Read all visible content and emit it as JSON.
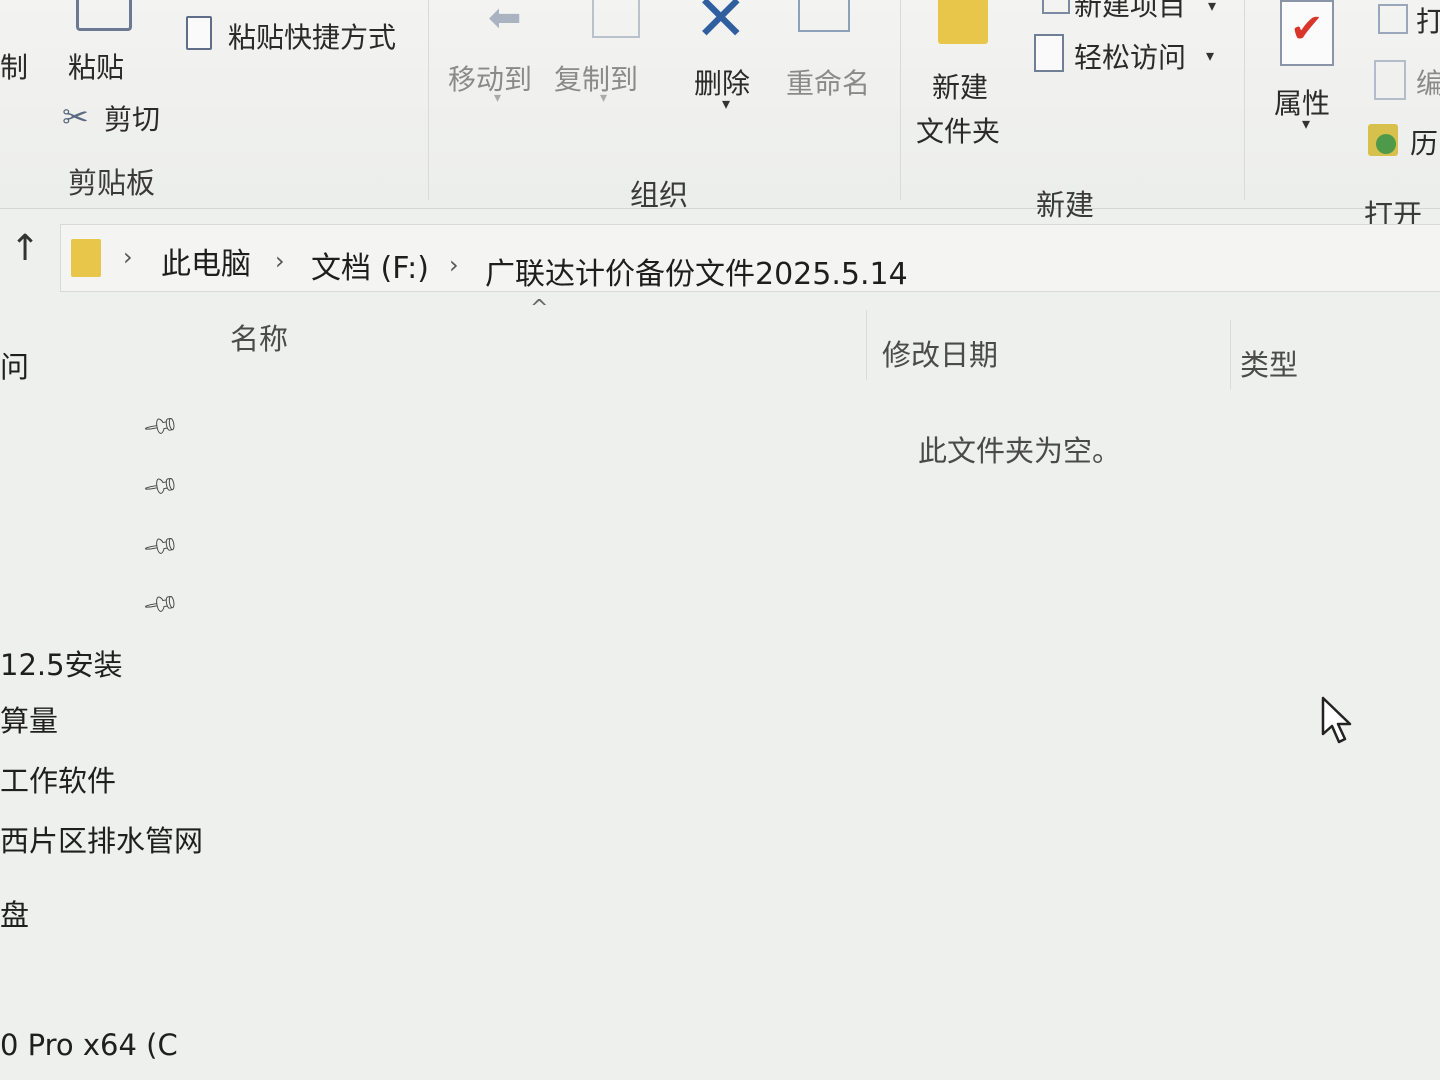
{
  "ribbon": {
    "clipboard": {
      "copy_label": "制",
      "paste_label": "粘贴",
      "paste_shortcut_label": "粘贴快捷方式",
      "cut_label": "剪切",
      "group_label": "剪贴板"
    },
    "organize": {
      "move_to_label": "移动到",
      "copy_to_label": "复制到",
      "delete_label": "删除",
      "rename_label": "重命名",
      "group_label": "组织"
    },
    "new": {
      "new_item_label": "新建项目",
      "easy_access_label": "轻松访问",
      "new_folder_line1": "新建",
      "new_folder_line2": "文件夹",
      "group_label": "新建"
    },
    "open": {
      "properties_label": "属性",
      "open_label": "打",
      "edit_label": "编",
      "history_label": "历",
      "group_label": "打开"
    }
  },
  "address_bar": {
    "crumbs": [
      "此电脑",
      "文档 (F:)",
      "广联达计价备份文件2025.5.14"
    ]
  },
  "columns": {
    "name": "名称",
    "date_modified": "修改日期",
    "type": "类型"
  },
  "content": {
    "empty_message": "此文件夹为空。"
  },
  "nav_pane": {
    "quick_access_label": "问",
    "items": [
      "12.5安装",
      "算量",
      "工作软件",
      "西片区排水管网",
      "盘",
      "0 Pro x64 (C"
    ]
  },
  "colors": {
    "background": "#eef0ed",
    "folder": "#e8c64a",
    "accent_red": "#d9352b",
    "delete_blue": "#2f5f9f"
  }
}
